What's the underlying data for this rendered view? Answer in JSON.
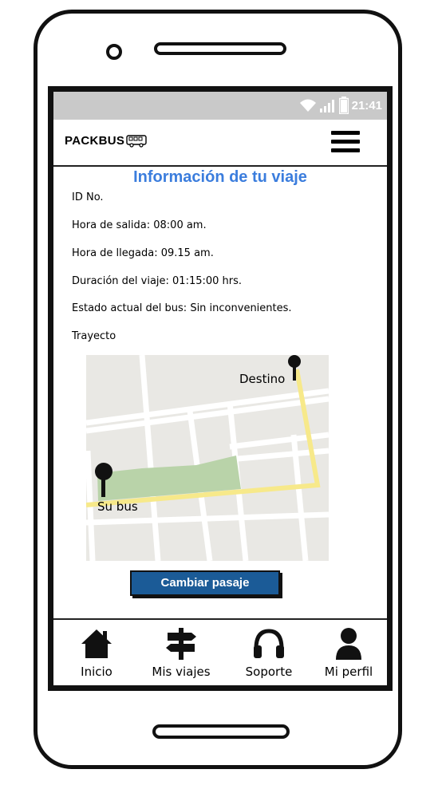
{
  "status_bar": {
    "time": "21:41"
  },
  "header": {
    "brand": "PACKBUS"
  },
  "page": {
    "title": "Información de tu viaje",
    "fields": [
      "ID No.",
      "Hora de salida: 08:00 am.",
      "Hora de llegada: 09.15 am.",
      "Duración del viaje: 01:15:00 hrs.",
      "Estado actual del bus: Sin inconvenientes.",
      "Trayecto"
    ]
  },
  "map": {
    "destination_label": "Destino",
    "bus_label": "Su bus",
    "route_color": "#f7e98a",
    "park_color": "#b9d3a9"
  },
  "actions": {
    "change_ticket": "Cambiar pasaje"
  },
  "bottom_nav": {
    "items": [
      {
        "label": "Inicio",
        "icon": "home-icon"
      },
      {
        "label": "Mis viajes",
        "icon": "signpost-icon"
      },
      {
        "label": "Soporte",
        "icon": "headset-icon"
      },
      {
        "label": "Mi perfil",
        "icon": "user-icon"
      }
    ]
  },
  "colors": {
    "accent": "#3b7ddd",
    "button": "#1b5b97",
    "status_bar": "#c9c9c9"
  }
}
